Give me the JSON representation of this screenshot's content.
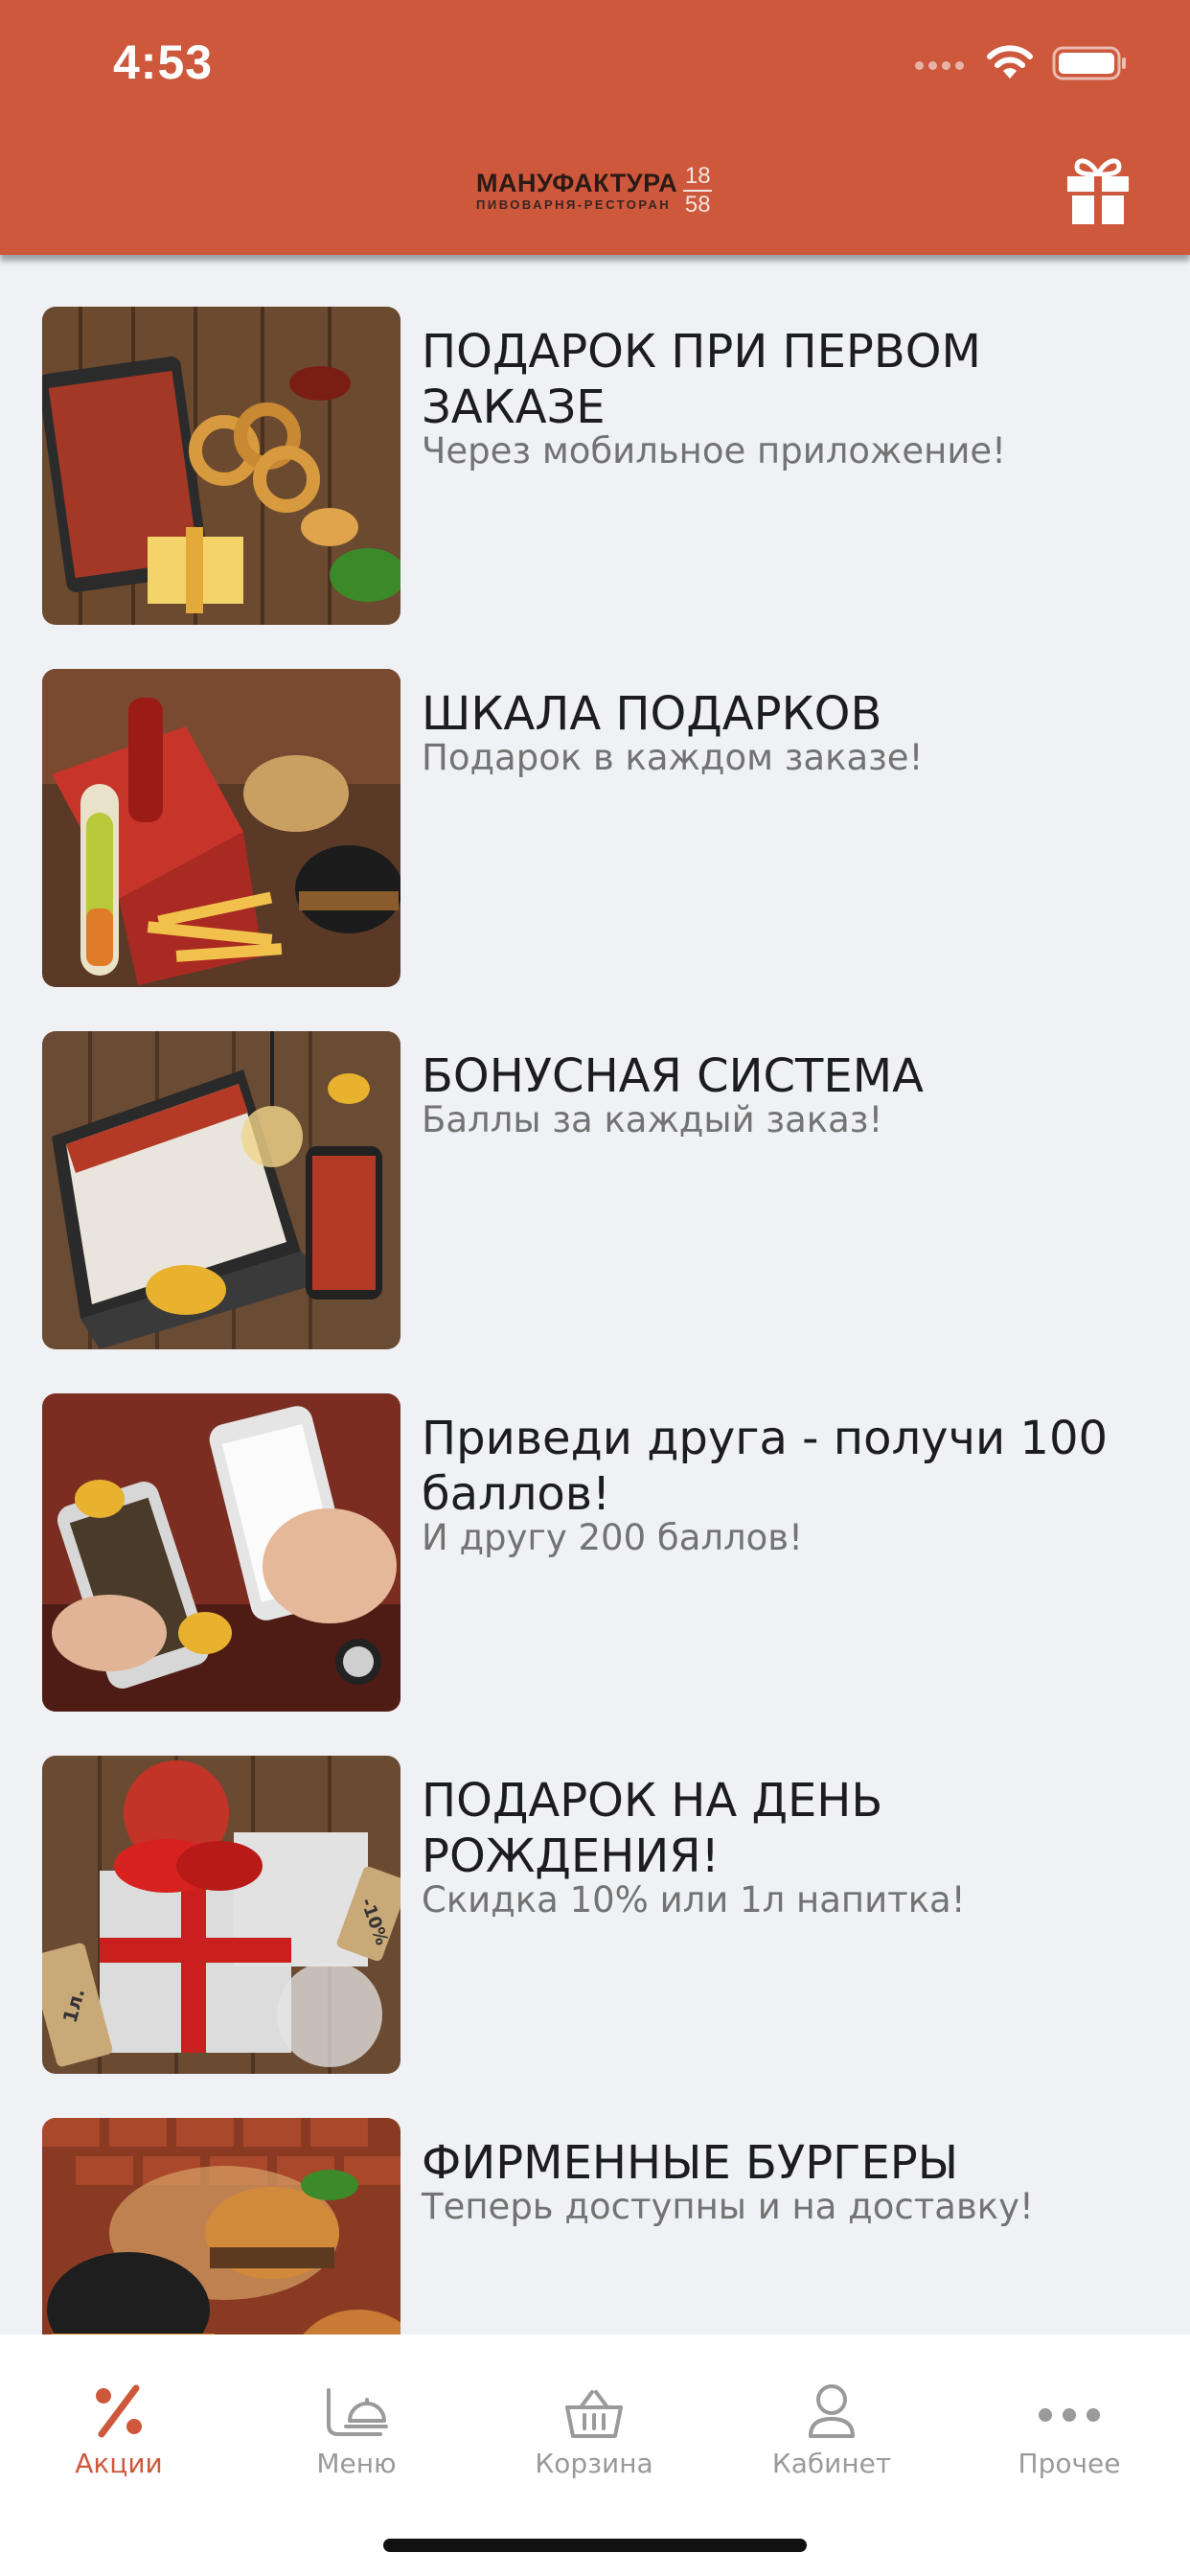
{
  "status_bar": {
    "time": "4:53"
  },
  "header": {
    "logo_main": "МАНУФАКТУРА",
    "logo_sub": "ПИВОВАРНЯ-РЕСТОРАН",
    "logo_year_top": "18",
    "logo_year_bottom": "58",
    "accent_color": "#cd583c"
  },
  "promos": [
    {
      "title": "ПОДАРОК ПРИ ПЕРВОМ ЗАКАЗЕ",
      "subtitle": "Через мобильное приложение!"
    },
    {
      "title": "ШКАЛА ПОДАРКОВ",
      "subtitle": "Подарок в каждом заказе!"
    },
    {
      "title": "БОНУСНАЯ СИСТЕМА",
      "subtitle": "Баллы за каждый заказ!"
    },
    {
      "title": "Приведи друга - получи 100 баллов!",
      "subtitle": "И другу 200 баллов!"
    },
    {
      "title": "ПОДАРОК НА ДЕНЬ РОЖДЕНИЯ!",
      "subtitle": "Скидка 10% или 1л напитка!"
    },
    {
      "title": "ФИРМЕННЫЕ БУРГЕРЫ",
      "subtitle": "Теперь доступны и на доставку!"
    }
  ],
  "thumb_text": {
    "birthday_tag": "-10%",
    "birthday_tag2": "1л."
  },
  "tabs": [
    {
      "label": "Акции",
      "icon": "percent-icon",
      "active": true
    },
    {
      "label": "Меню",
      "icon": "menu-cloche-icon",
      "active": false
    },
    {
      "label": "Корзина",
      "icon": "basket-icon",
      "active": false
    },
    {
      "label": "Кабинет",
      "icon": "user-icon",
      "active": false
    },
    {
      "label": "Прочее",
      "icon": "more-dots-icon",
      "active": false
    }
  ]
}
